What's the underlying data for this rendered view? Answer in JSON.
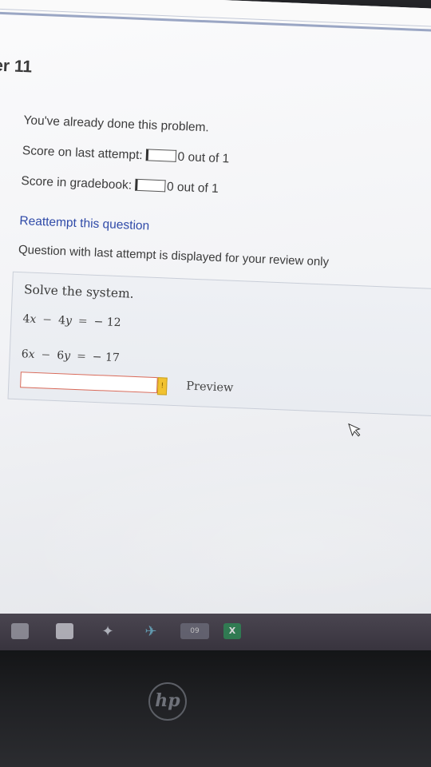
{
  "header": {
    "chapter_title": "er 11"
  },
  "status": {
    "already_done": "You've already done this problem.",
    "last_attempt_label": "Score on last attempt:",
    "last_attempt_value": "0 out of 1",
    "gradebook_label": "Score in gradebook:",
    "gradebook_value": "0 out of 1",
    "reattempt_link": "Reattempt this question",
    "review_note": "Question with last attempt is displayed for your review only"
  },
  "question": {
    "prompt": "Solve the system.",
    "equations": [
      {
        "a": "4",
        "x": "x",
        "op": "−",
        "b": "4",
        "y": "y",
        "eq": "=",
        "rhs": "− 12"
      },
      {
        "a": "6",
        "x": "x",
        "op": "−",
        "b": "6",
        "y": "y",
        "eq": "=",
        "rhs": "− 17"
      }
    ],
    "answer_value": "",
    "preview_label": "Preview"
  },
  "taskbar": {
    "icons": [
      "file-manager-icon",
      "store-icon",
      "dropbox-icon",
      "app-icon",
      "weather-icon",
      "excel-icon"
    ],
    "badge": "09"
  },
  "device": {
    "logo": "hp"
  }
}
